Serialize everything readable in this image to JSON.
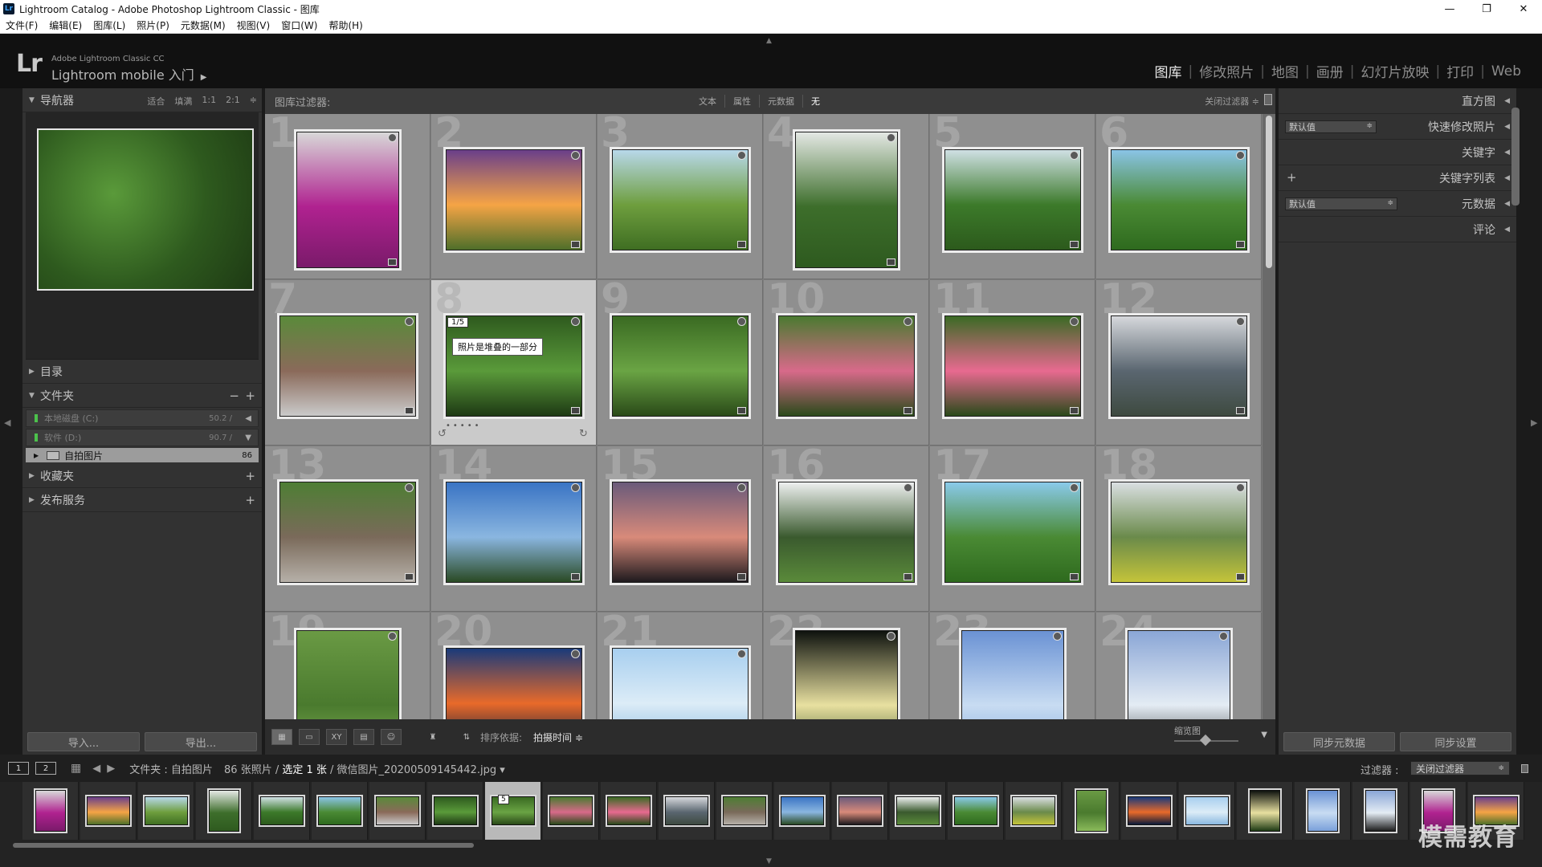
{
  "window": {
    "title": "Lightroom Catalog - Adobe Photoshop Lightroom Classic - 图库",
    "app_icon": "Lr",
    "minimize": "—",
    "maximize": "❐",
    "close": "✕"
  },
  "menu": [
    "文件(F)",
    "编辑(E)",
    "图库(L)",
    "照片(P)",
    "元数据(M)",
    "视图(V)",
    "窗口(W)",
    "帮助(H)"
  ],
  "identity": {
    "logo": "Lr",
    "brand_small": "Adobe Lightroom Classic CC",
    "brand_main": "Lightroom mobile 入门",
    "modules": [
      "图库",
      "修改照片",
      "地图",
      "画册",
      "幻灯片放映",
      "打印",
      "Web"
    ],
    "active_module": "图库"
  },
  "left_panel": {
    "navigator": {
      "label": "导航器",
      "zoom_options": [
        "适合",
        "填满",
        "1:1",
        "2:1"
      ]
    },
    "catalog": {
      "label": "目录"
    },
    "folders": {
      "label": "文件夹",
      "volumes": [
        {
          "name": "本地磁盘 (C:)",
          "size": "50.2 /"
        },
        {
          "name": "软件 (D:)",
          "size": "90.7 /"
        }
      ],
      "folder": {
        "name": "自拍图片",
        "count": "86"
      }
    },
    "collections": {
      "label": "收藏夹"
    },
    "publish": {
      "label": "发布服务"
    },
    "import_button": "导入...",
    "export_button": "导出..."
  },
  "filter_bar": {
    "title": "图库过滤器:",
    "filters": [
      "文本",
      "属性",
      "元数据",
      "无"
    ],
    "active_filter": "无",
    "close_filter": "关闭过滤器 ≑"
  },
  "grid": {
    "selected_index": 8,
    "stack_badge": "1/5",
    "tooltip": "照片是堆叠的一部分",
    "cells": [
      {
        "n": "1",
        "orient": "p",
        "colors": [
          "#d8d8d8",
          "#b02290",
          "#7a1a6a"
        ]
      },
      {
        "n": "2",
        "orient": "l",
        "colors": [
          "#6a3f8a",
          "#f5a445",
          "#4e6f2a"
        ]
      },
      {
        "n": "3",
        "orient": "l",
        "colors": [
          "#b8d8ea",
          "#6e9e3e",
          "#3f6e22"
        ]
      },
      {
        "n": "4",
        "orient": "p",
        "colors": [
          "#e4e8e4",
          "#3d6e2b",
          "#2e5a1f"
        ]
      },
      {
        "n": "5",
        "orient": "l",
        "colors": [
          "#cfe0e4",
          "#3c7a2a",
          "#2c5a1c"
        ]
      },
      {
        "n": "6",
        "orient": "l",
        "colors": [
          "#8ac4e6",
          "#4a8a34",
          "#2e6a1e"
        ]
      },
      {
        "n": "7",
        "orient": "l",
        "colors": [
          "#5a8a3a",
          "#8a6a5a",
          "#cacaca"
        ]
      },
      {
        "n": "8",
        "orient": "l",
        "colors": [
          "#2e5a1e",
          "#5a9a3a",
          "#1e3a14"
        ]
      },
      {
        "n": "9",
        "orient": "l",
        "colors": [
          "#3a6a22",
          "#6aa444",
          "#2a4a18"
        ]
      },
      {
        "n": "10",
        "orient": "l",
        "colors": [
          "#4a7a30",
          "#d86a8a",
          "#2a4a1a"
        ]
      },
      {
        "n": "11",
        "orient": "l",
        "colors": [
          "#3a6a24",
          "#e86a90",
          "#2a4a1a"
        ]
      },
      {
        "n": "12",
        "orient": "l",
        "colors": [
          "#d6d8dc",
          "#5a6670",
          "#3e4a40"
        ]
      },
      {
        "n": "13",
        "orient": "l",
        "colors": [
          "#4e7e34",
          "#7a6a5a",
          "#b6b0a8"
        ]
      },
      {
        "n": "14",
        "orient": "l",
        "colors": [
          "#3a74c4",
          "#8ab6e0",
          "#2a4a24"
        ]
      },
      {
        "n": "15",
        "orient": "l",
        "colors": [
          "#6a5a7a",
          "#d88a7a",
          "#1e1a1e"
        ]
      },
      {
        "n": "16",
        "orient": "l",
        "colors": [
          "#eef0f0",
          "#3a5a2e",
          "#5a8a3a"
        ]
      },
      {
        "n": "17",
        "orient": "l",
        "colors": [
          "#8acaea",
          "#4a8a34",
          "#2e6a1e"
        ]
      },
      {
        "n": "18",
        "orient": "l",
        "colors": [
          "#dadfe2",
          "#6a8a4a",
          "#c4c43a"
        ]
      },
      {
        "n": "19",
        "orient": "p",
        "colors": [
          "#6a9a44",
          "#4a7a2e",
          "#8aba5a"
        ]
      },
      {
        "n": "20",
        "orient": "l",
        "colors": [
          "#1a3a7a",
          "#e86a2a",
          "#0a1a3a"
        ]
      },
      {
        "n": "21",
        "orient": "l",
        "colors": [
          "#a8cfef",
          "#dcecf7",
          "#8ab8e0"
        ]
      },
      {
        "n": "22",
        "orient": "p",
        "colors": [
          "#0e120e",
          "#e8e0a0",
          "#1e3a14"
        ]
      },
      {
        "n": "23",
        "orient": "p",
        "colors": [
          "#6a92d4",
          "#c8dcf2",
          "#7aa0da"
        ]
      },
      {
        "n": "24",
        "orient": "p",
        "colors": [
          "#8aa6d6",
          "#e4ecf4",
          "#1e1e1e"
        ]
      }
    ]
  },
  "toolbar": {
    "sort_label": "排序依据:",
    "sort_value": "拍摄时间 ≑",
    "thumbnail_label": "缩览图"
  },
  "right_panel": {
    "histogram": "直方图",
    "quick_develop": "快速修改照片",
    "quick_preset": "默认值",
    "keywording": "关键字",
    "keyword_list": "关键字列表",
    "metadata": "元数据",
    "metadata_preset": "默认值",
    "comments": "评论",
    "sync_metadata": "同步元数据",
    "sync_settings": "同步设置"
  },
  "filmstrip_header": {
    "screen1": "1",
    "screen2": "2",
    "source_prefix": "文件夹 : 自拍图片",
    "count": "86 张照片 /",
    "selected": "选定 1 张",
    "filename": "/ 微信图片_20200509145442.jpg ▾",
    "filter_label": "过滤器 :",
    "filter_value": "关闭过滤器"
  },
  "filmstrip": {
    "active_index": 8,
    "active_badge": "5"
  },
  "watermark": "模需教育"
}
